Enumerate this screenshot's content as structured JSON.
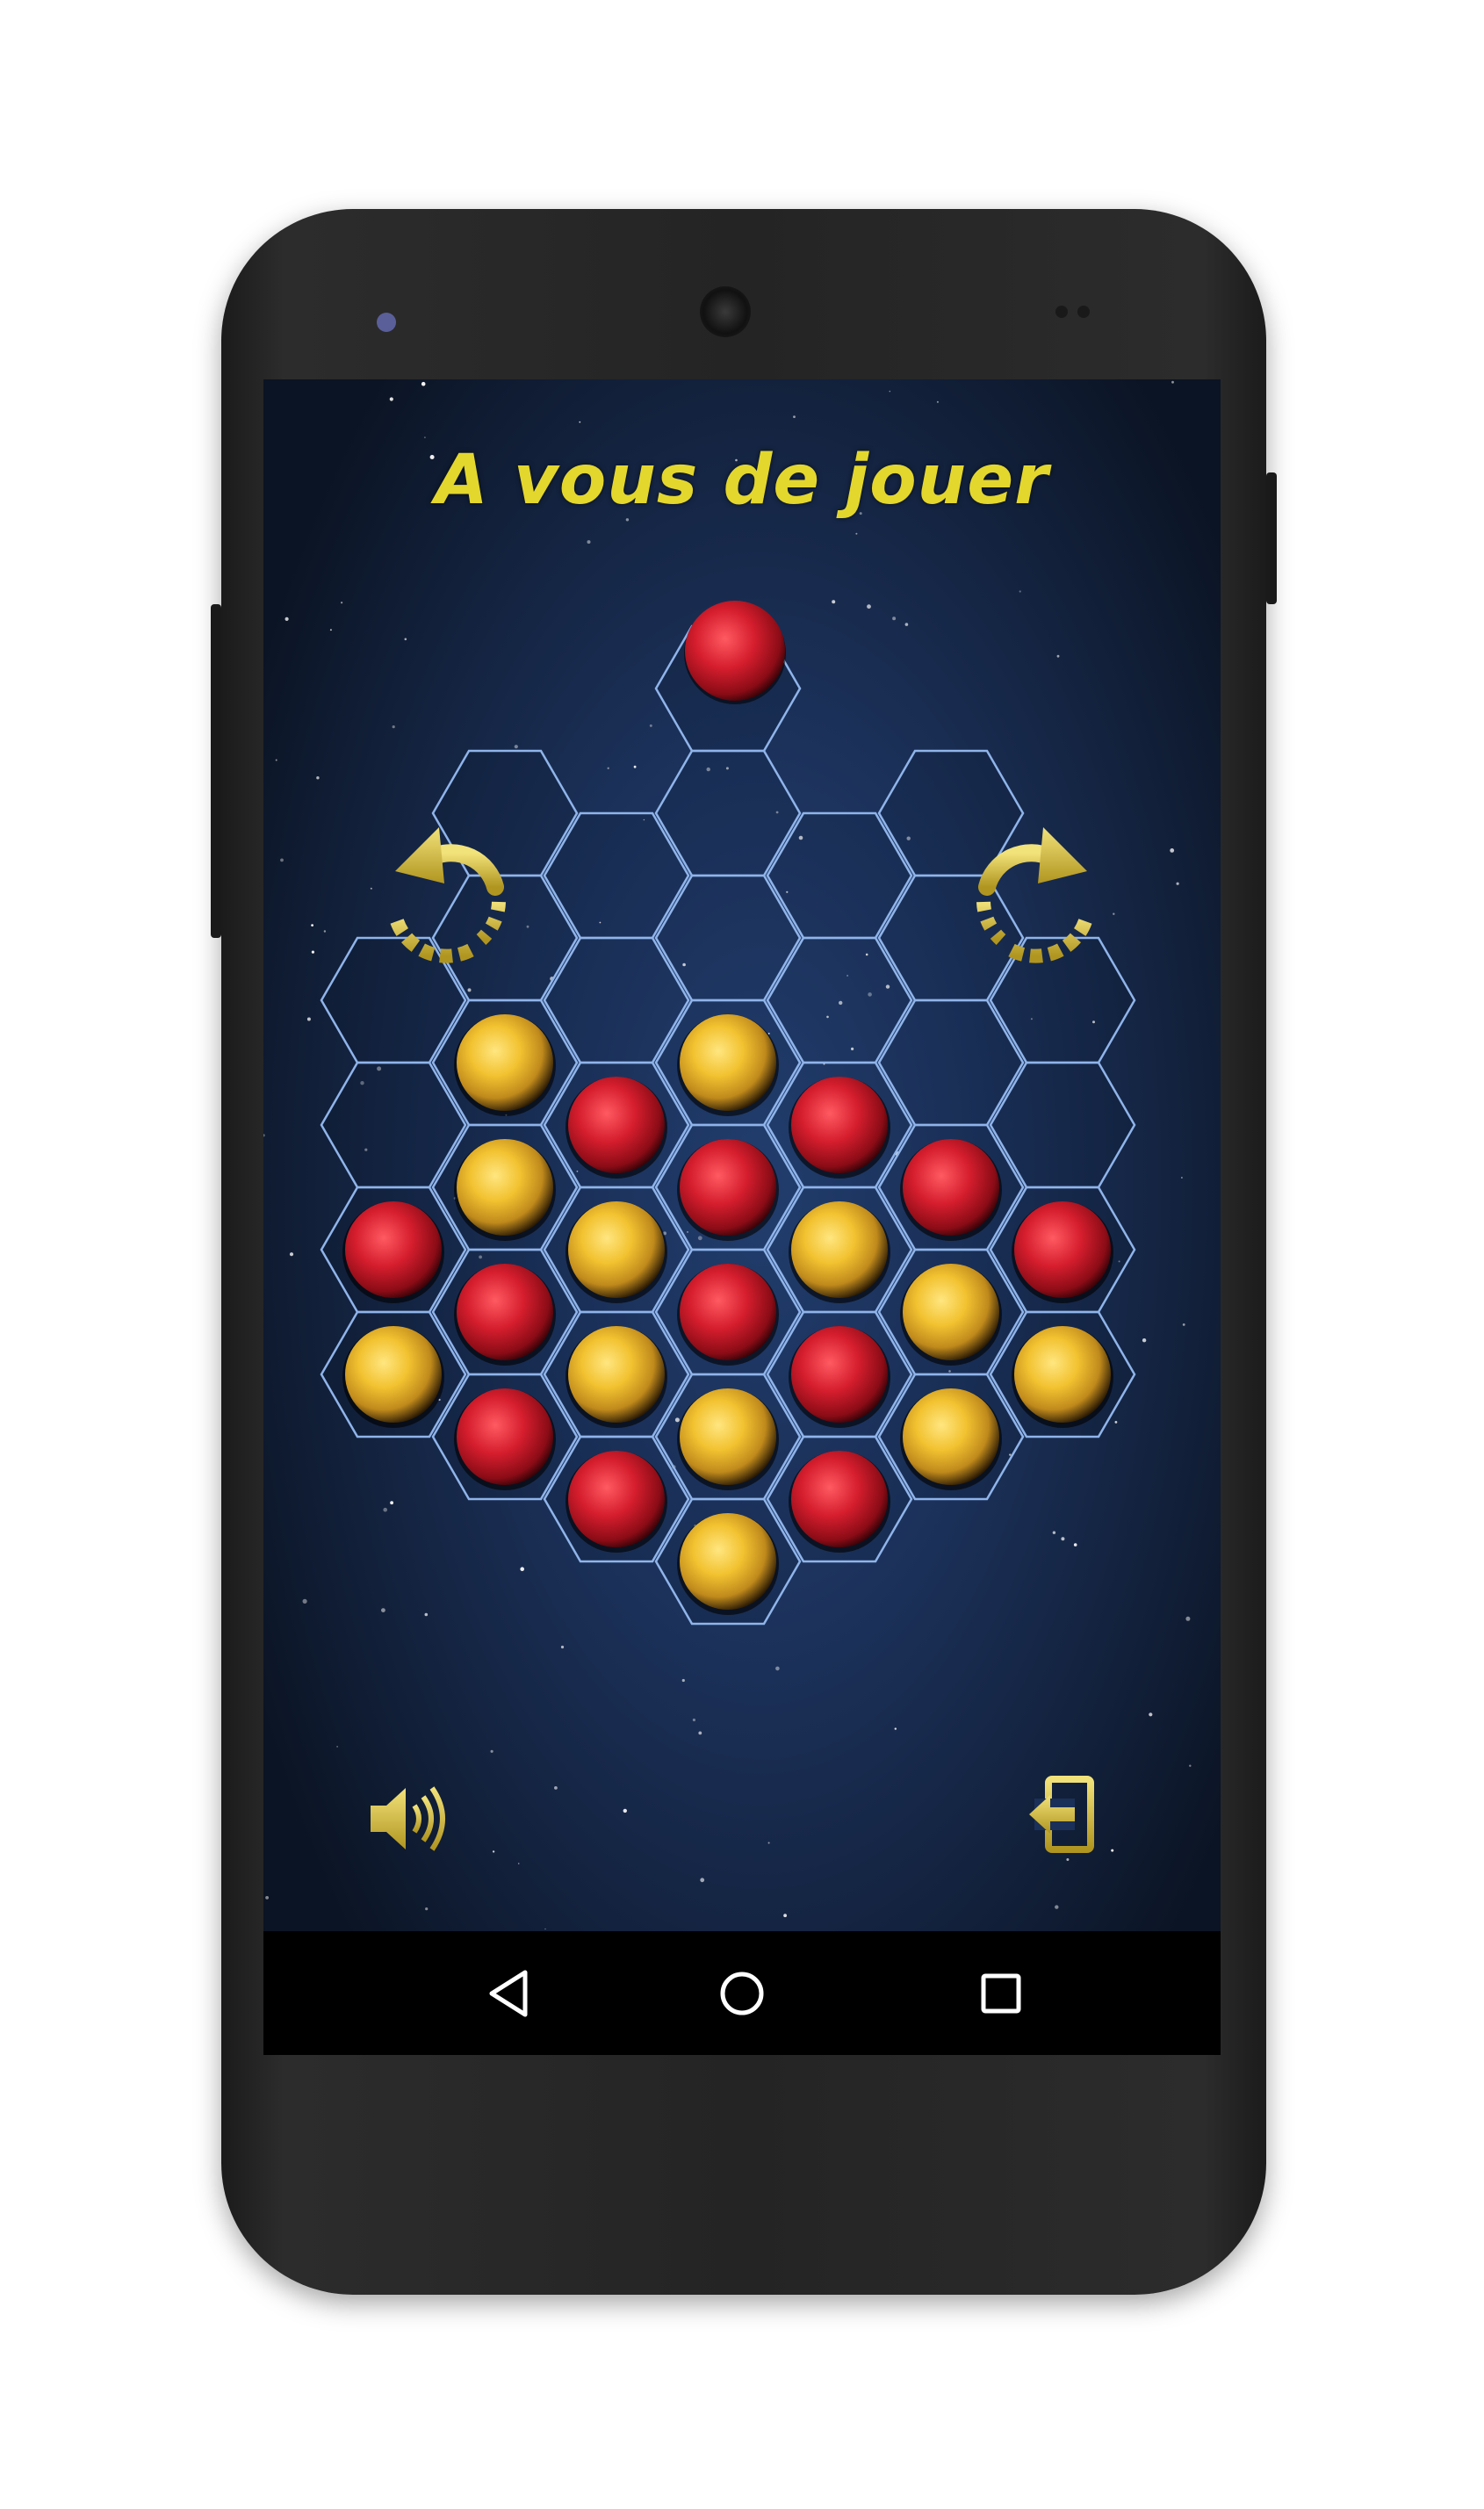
{
  "screen": {
    "title": "A vous de jouer",
    "current_piece": "red"
  },
  "board": {
    "pieces": [
      {
        "c": 1,
        "r": 2,
        "color": "yellow"
      },
      {
        "c": 3,
        "r": 2,
        "color": "yellow"
      },
      {
        "c": 2,
        "r": 2,
        "color": "red"
      },
      {
        "c": 4,
        "r": 2,
        "color": "red"
      },
      {
        "c": 1,
        "r": 3,
        "color": "yellow"
      },
      {
        "c": 3,
        "r": 3,
        "color": "red"
      },
      {
        "c": 5,
        "r": 3,
        "color": "red"
      },
      {
        "c": 0,
        "r": 3,
        "color": "red"
      },
      {
        "c": 2,
        "r": 3,
        "color": "yellow"
      },
      {
        "c": 4,
        "r": 3,
        "color": "yellow"
      },
      {
        "c": 6,
        "r": 3,
        "color": "red"
      },
      {
        "c": 1,
        "r": 4,
        "color": "red"
      },
      {
        "c": 3,
        "r": 4,
        "color": "red"
      },
      {
        "c": 5,
        "r": 4,
        "color": "yellow"
      },
      {
        "c": 0,
        "r": 4,
        "color": "yellow"
      },
      {
        "c": 2,
        "r": 4,
        "color": "yellow"
      },
      {
        "c": 4,
        "r": 4,
        "color": "red"
      },
      {
        "c": 6,
        "r": 4,
        "color": "yellow"
      },
      {
        "c": 1,
        "r": 5,
        "color": "red"
      },
      {
        "c": 3,
        "r": 5,
        "color": "yellow"
      },
      {
        "c": 5,
        "r": 5,
        "color": "yellow"
      },
      {
        "c": 2,
        "r": 5,
        "color": "red"
      },
      {
        "c": 4,
        "r": 5,
        "color": "red"
      },
      {
        "c": 3,
        "r": 6,
        "color": "yellow"
      }
    ]
  },
  "controls": {
    "rotate_left_icon": "rotate-left-icon",
    "rotate_right_icon": "rotate-right-icon",
    "sound_icon": "speaker-icon",
    "exit_icon": "exit-icon"
  },
  "navbar": {
    "back_icon": "back-triangle-icon",
    "home_icon": "home-circle-icon",
    "recents_icon": "recents-square-icon"
  },
  "colors": {
    "accent_gold": "#e3d72d",
    "grid_line": "#8fb4ea",
    "red_piece": "#d61e2e",
    "yellow_piece": "#f2c230"
  }
}
